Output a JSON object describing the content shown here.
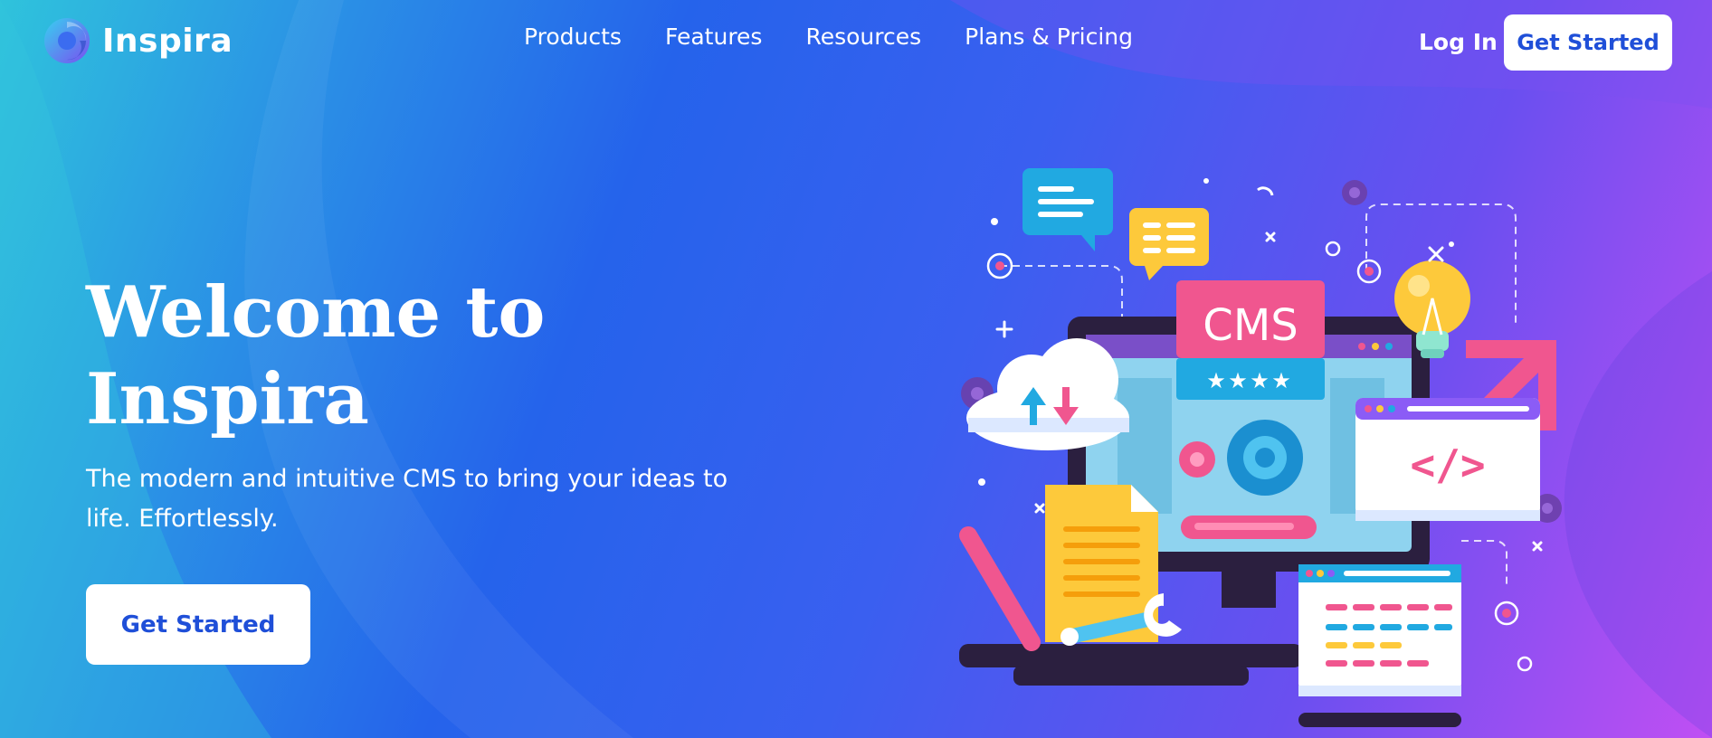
{
  "colors": {
    "accent": "#1f4fd8",
    "pink": "#f0568f",
    "yellow": "#fdc93b",
    "cyan": "#21a9e1",
    "dark": "#2b1f3f"
  },
  "brand": {
    "name": "Inspira",
    "logo_icon": "swirl-logo-icon"
  },
  "nav": {
    "items": [
      {
        "label": "Products"
      },
      {
        "label": "Features"
      },
      {
        "label": "Resources"
      },
      {
        "label": "Plans & Pricing"
      }
    ],
    "login_label": "Log In",
    "cta_label": "Get Started"
  },
  "hero": {
    "title_line1": "Welcome to",
    "title_line2": "Inspira",
    "subtitle": "The modern and intuitive CMS to bring your ideas to life. Effortlessly.",
    "cta_label": "Get Started"
  },
  "illustration": {
    "cms_label": "CMS",
    "stars": 4,
    "code_symbol": "</>",
    "icons": [
      "chat-bubble-icon",
      "message-icon",
      "cloud-upload-download-icon",
      "gear-icon",
      "lightbulb-icon",
      "arrow-up-right-icon",
      "code-window-icon",
      "document-icon",
      "wrench-icon",
      "monitor-icon"
    ]
  }
}
